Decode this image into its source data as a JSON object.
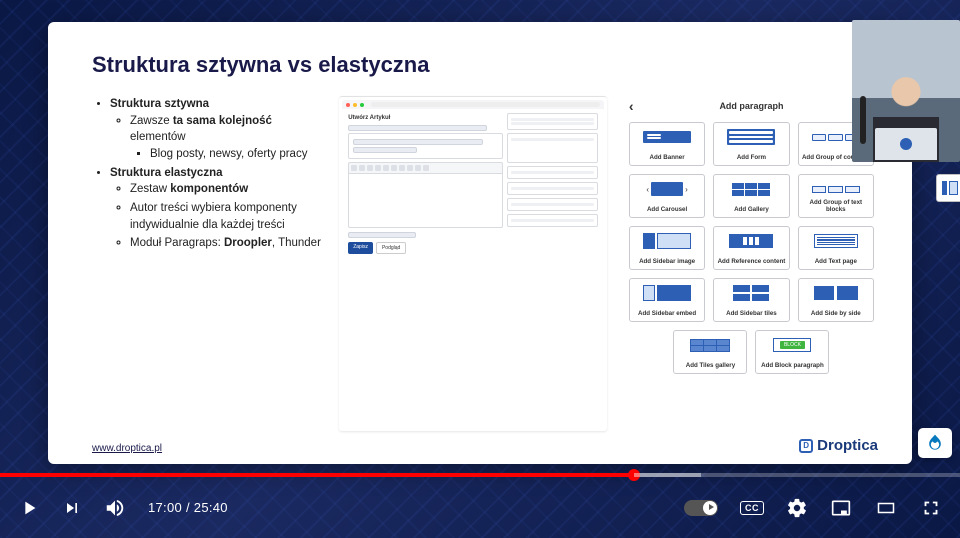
{
  "slide": {
    "title": "Struktura sztywna vs elastyczna",
    "bullets": {
      "rigid_title": "Struktura sztywna",
      "rigid_1_pre": "Zawsze ",
      "rigid_1_bold": "ta sama kolejność",
      "rigid_1_post": " elementów",
      "rigid_1_sub": "Blog posty, newsy, oferty pracy",
      "elastic_title": "Struktura elastyczna",
      "elastic_1_pre": "Zestaw ",
      "elastic_1_bold": "komponentów",
      "elastic_2": "Autor treści wybiera komponenty indywidualnie dla każdej treści",
      "elastic_3_pre": "Moduł Paragraps: ",
      "elastic_3_bold": "Droopler",
      "elastic_3_post": ", Thunder"
    },
    "form": {
      "heading": "Utwórz Artykuł",
      "save": "Zapisz",
      "preview": "Podgląd"
    },
    "paragraph_panel": {
      "title": "Add paragraph",
      "items": {
        "banner": "Add Banner",
        "form": "Add Form",
        "counters": "Add Group of counters",
        "carousel": "Add Carousel",
        "gallery": "Add Gallery",
        "textblocks": "Add Group of text blocks",
        "sidebar_image": "Add Sidebar image",
        "reference": "Add Reference content",
        "textpage": "Add Text page",
        "sidebar_embed": "Add Sidebar embed",
        "sidebar_tiles": "Add Sidebar tiles",
        "sidebyside": "Add Side by side",
        "tiles_gallery": "Add Tiles gallery",
        "block": "Add Block paragraph"
      },
      "block_badge": "BLOCK"
    },
    "footer_url": "www.droptica.pl",
    "footer_brand": "Droptica"
  },
  "player": {
    "current_time": "17:00",
    "duration": "25:40",
    "cc_label": "CC"
  }
}
